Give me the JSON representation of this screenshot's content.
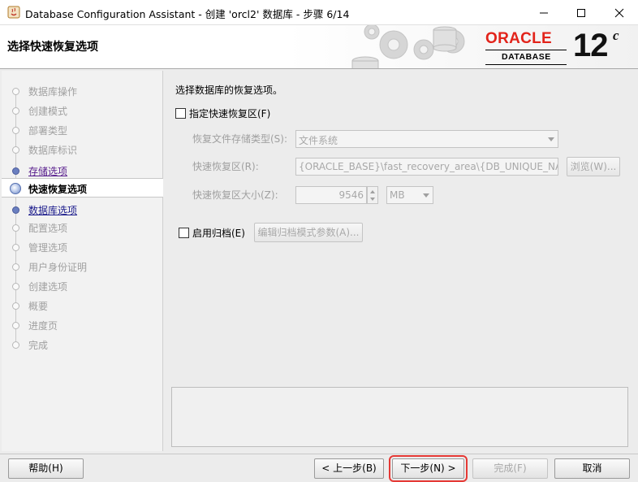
{
  "window": {
    "title": "Database Configuration Assistant - 创建 'orcl2' 数据库 - 步骤 6/14"
  },
  "banner": {
    "step_title": "选择快速恢复选项",
    "logo_oracle": "ORACLE",
    "logo_database": "DATABASE",
    "logo_version": "12",
    "logo_version_suffix": "c"
  },
  "nav": {
    "items": [
      {
        "label": "数据库操作",
        "state": "done"
      },
      {
        "label": "创建模式",
        "state": "done"
      },
      {
        "label": "部署类型",
        "state": "done"
      },
      {
        "label": "数据库标识",
        "state": "done"
      },
      {
        "label": "存储选项",
        "state": "link"
      },
      {
        "label": "快速恢复选项",
        "state": "active"
      },
      {
        "label": "数据库选项",
        "state": "link2"
      },
      {
        "label": "配置选项",
        "state": "pending"
      },
      {
        "label": "管理选项",
        "state": "pending"
      },
      {
        "label": "用户身份证明",
        "state": "pending"
      },
      {
        "label": "创建选项",
        "state": "pending"
      },
      {
        "label": "概要",
        "state": "pending"
      },
      {
        "label": "进度页",
        "state": "pending"
      },
      {
        "label": "完成",
        "state": "pending"
      }
    ]
  },
  "content": {
    "heading": "选择数据库的恢复选项。",
    "fra_checkbox_label": "指定快速恢复区(F)",
    "storage_type_label": "恢复文件存储类型(S):",
    "storage_type_value": "文件系统",
    "fra_location_label": "快速恢复区(R):",
    "fra_location_value": "{ORACLE_BASE}\\fast_recovery_area\\{DB_UNIQUE_NAME}",
    "browse_label": "浏览(W)...",
    "fra_size_label": "快速恢复区大小(Z):",
    "fra_size_value": "9546",
    "fra_size_unit": "MB",
    "archive_checkbox_label": "启用归档(E)",
    "archive_params_label": "编辑归档模式参数(A)..."
  },
  "footer": {
    "help_label": "帮助(H)",
    "back_label": "< 上一步(B)",
    "next_label": "下一步(N) >",
    "finish_label": "完成(F)",
    "cancel_label": "取消"
  },
  "colors": {
    "oracle_red": "#e2231a",
    "focus_outline": "#e53935",
    "visited_link": "#551a8b"
  }
}
